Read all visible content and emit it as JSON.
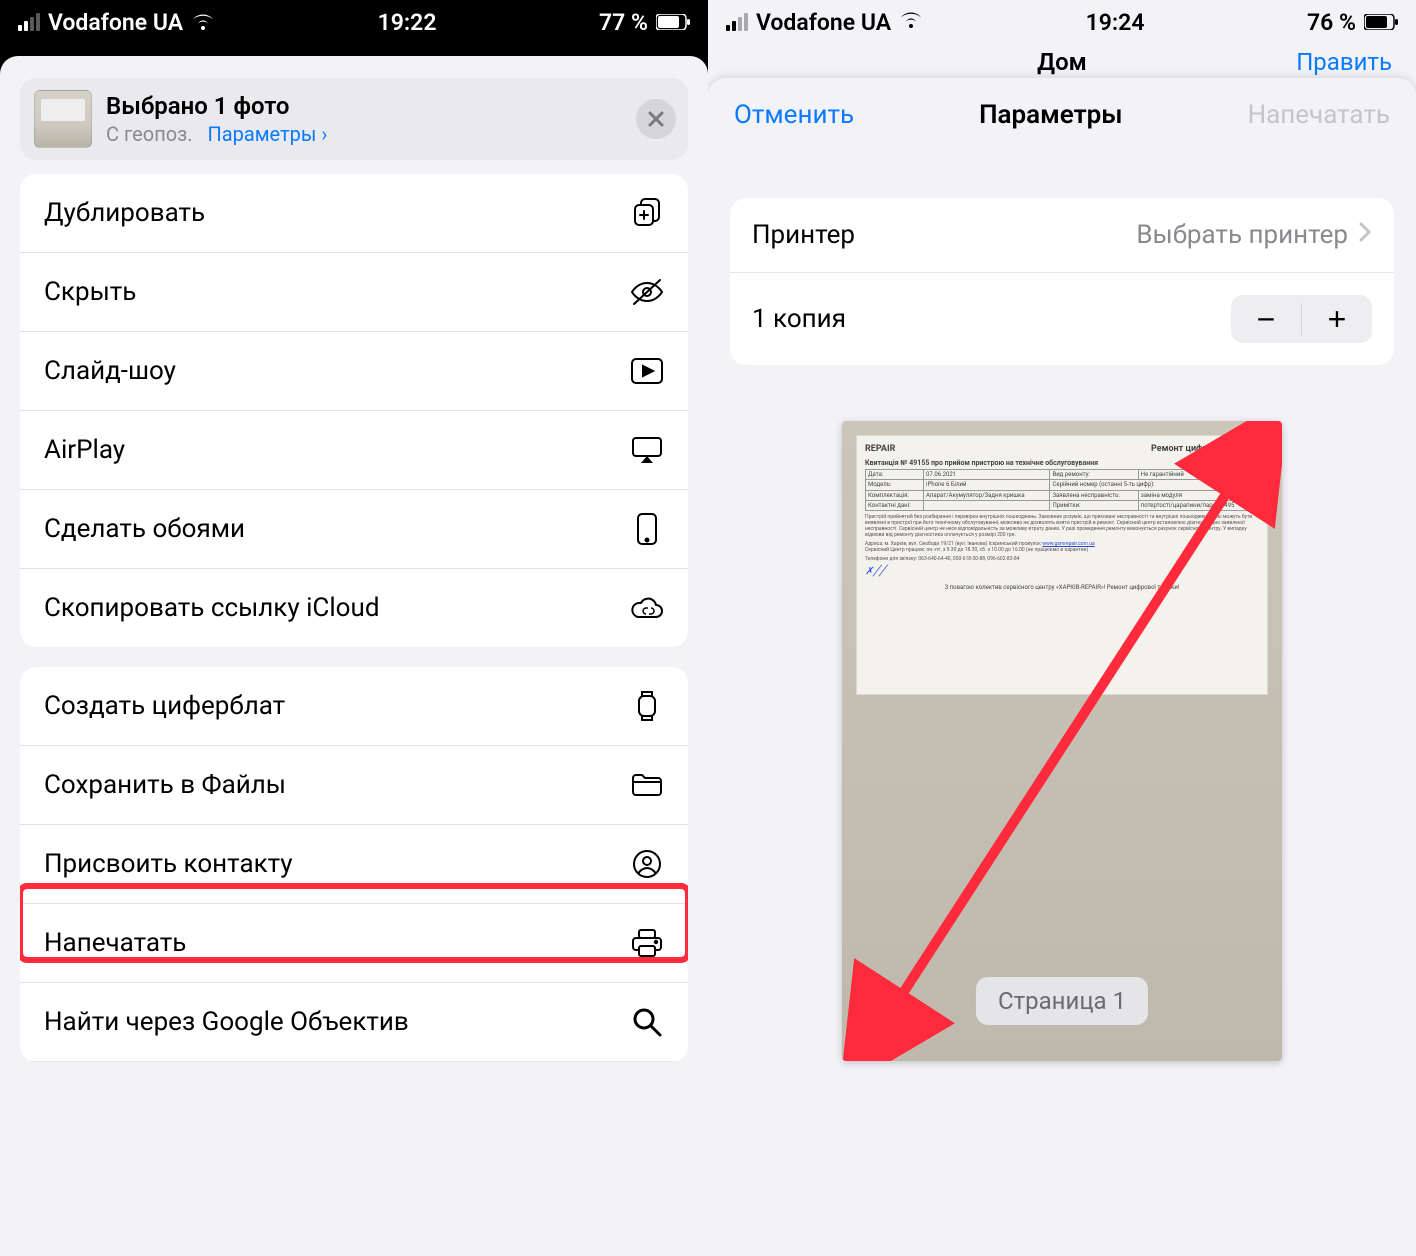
{
  "left": {
    "status": {
      "carrier": "Vodafone UA",
      "time": "19:22",
      "battery": "77 %"
    },
    "share_header": {
      "title": "Выбрано 1 фото",
      "sub_prefix": "С геопоз.",
      "options_link": "Параметры",
      "chevron": "›"
    },
    "group1": [
      {
        "label": "Дублировать",
        "icon": "copy-plus-icon"
      },
      {
        "label": "Скрыть",
        "icon": "eye-off-icon"
      },
      {
        "label": "Слайд-шоу",
        "icon": "play-rect-icon"
      },
      {
        "label": "AirPlay",
        "icon": "airplay-icon"
      },
      {
        "label": "Сделать обоями",
        "icon": "phone-icon"
      },
      {
        "label": "Скопировать ссылку iCloud",
        "icon": "cloud-link-icon"
      }
    ],
    "group2": [
      {
        "label": "Создать циферблат",
        "icon": "watch-icon"
      },
      {
        "label": "Сохранить в Файлы",
        "icon": "folder-icon"
      },
      {
        "label": "Присвоить контакту",
        "icon": "contact-icon"
      },
      {
        "label": "Напечатать",
        "icon": "printer-icon",
        "highlight": true
      },
      {
        "label": "Найти через Google Объектив",
        "icon": "search-icon"
      }
    ]
  },
  "right": {
    "status": {
      "carrier": "Vodafone UA",
      "time": "19:24",
      "battery": "76 %"
    },
    "nav": {
      "back_title": "Дом",
      "edit": "Править"
    },
    "modal": {
      "cancel": "Отменить",
      "title": "Параметры",
      "print": "Напечатать"
    },
    "settings": {
      "printer_label": "Принтер",
      "printer_value": "Выбрать принтер",
      "copies_label": "1 копия"
    },
    "preview": {
      "page_badge": "Страница 1",
      "doc": {
        "logo": "REPAIR",
        "title": "Ремонт цифрової техніки",
        "receipt_line": "Квитанція № 49155 про прийом пристрою на технічне обслуговування",
        "row_date_label": "Дата:",
        "row_date_val": "07.06.2021",
        "row_type_label": "Вид ремонту:",
        "row_type_val": "Не гарантійний",
        "row_model_label": "Модель:",
        "row_model_val": "iPhone 6 Білий",
        "row_serial_label": "Серійний номер (останні 5-ть цифр):",
        "row_equip_label": "Комплектація:",
        "row_equip_val": "Апарат/Акумулятор/Задня кришка",
        "row_fault_label": "Заявлена несправність:",
        "row_fault_val": "заміна модуля",
        "row_contact_label": "Контактні дані:",
        "row_notes_label": "Примітки:",
        "row_notes_val": "потертості/царапини/пароль 495",
        "url": "www.gsmrepair.com.ua",
        "phones": "Телефони для зв'язку: 063-640-64-40, 050-618-30-88, 096-602-83-84",
        "footer": "З повагою колектив сервісного центру «ХАРКІВ-REPAIR»! Ремонт цифрової техніки!"
      }
    }
  }
}
